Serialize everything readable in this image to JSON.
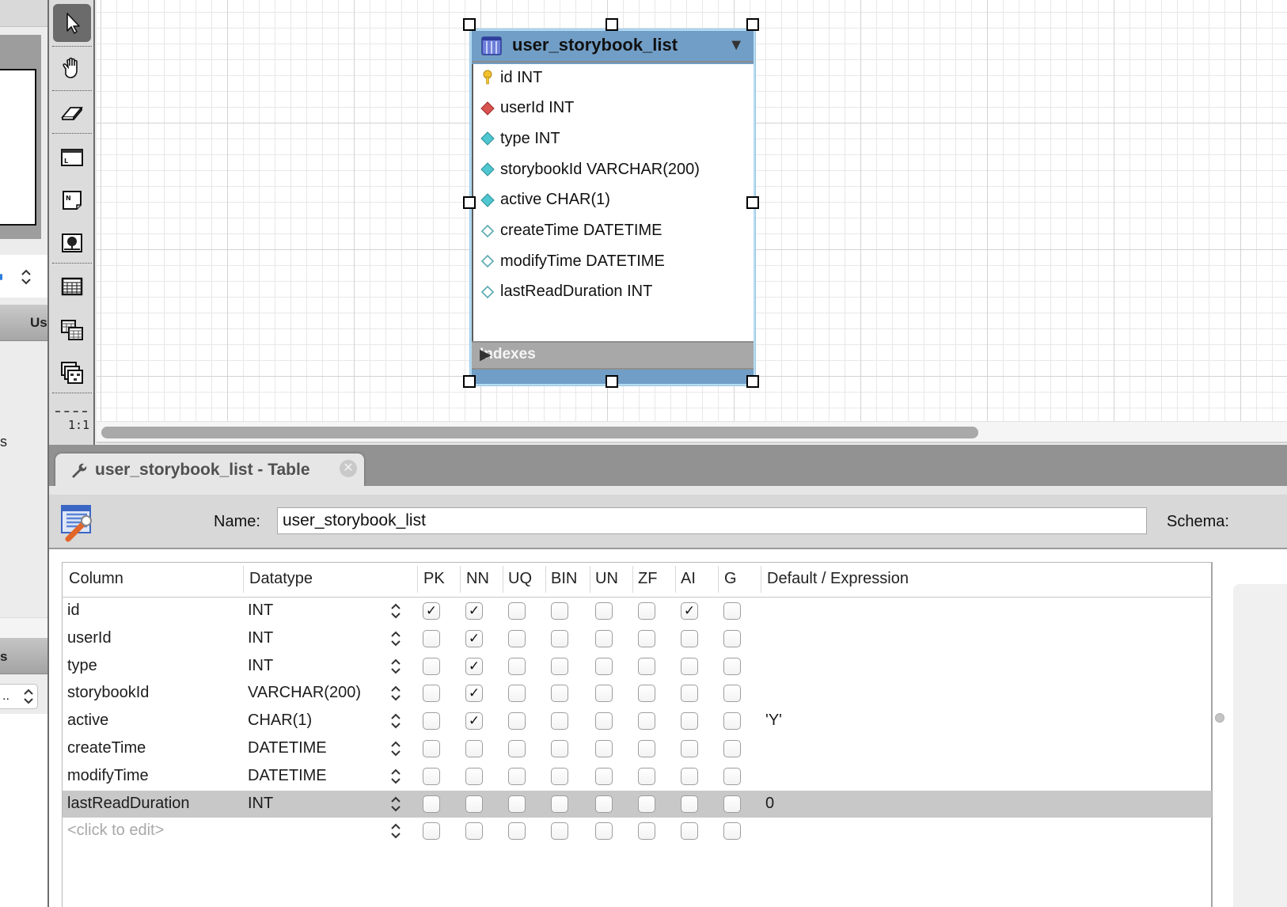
{
  "left_panel": {
    "header_fragment": "Us",
    "label_fragment": "s",
    "header2_fragment": "s",
    "select_fragment": "..",
    "stepper_glyph": "⌃⌄"
  },
  "toolbar": {
    "tools": [
      {
        "name": "pointer-tool",
        "icon": "pointer-icon",
        "active": true
      },
      {
        "name": "hand-tool",
        "icon": "hand-icon",
        "active": false
      },
      {
        "name": "eraser-tool",
        "icon": "eraser-icon",
        "active": false
      },
      {
        "name": "layer-tool",
        "icon": "layer-icon",
        "active": false
      },
      {
        "name": "note-tool",
        "icon": "note-icon",
        "active": false
      },
      {
        "name": "image-tool",
        "icon": "image-icon",
        "active": false
      },
      {
        "name": "new-table-tool",
        "icon": "table-icon",
        "active": false
      },
      {
        "name": "new-view-tool",
        "icon": "view-icon",
        "active": false
      },
      {
        "name": "new-routine-group-tool",
        "icon": "routine-group-icon",
        "active": false
      }
    ],
    "zoom_label": "1:1"
  },
  "diagram": {
    "table": {
      "title": "user_storybook_list",
      "columns": [
        {
          "text": "id INT",
          "key": "primary"
        },
        {
          "text": "userId INT",
          "key": "foreign"
        },
        {
          "text": "type INT",
          "key": "notnull"
        },
        {
          "text": "storybookId VARCHAR(200)",
          "key": "notnull"
        },
        {
          "text": "active CHAR(1)",
          "key": "notnull"
        },
        {
          "text": "createTime DATETIME",
          "key": "nullable"
        },
        {
          "text": "modifyTime DATETIME",
          "key": "nullable"
        },
        {
          "text": "lastReadDuration INT",
          "key": "nullable"
        }
      ],
      "indexes_label": "Indexes",
      "caret_down": "▼",
      "caret_right": "▶"
    },
    "colors": {
      "header": "#719ec6",
      "pk": "#f2c12e",
      "fk": "#d9534f",
      "nn": "#4fc6d0"
    }
  },
  "editor": {
    "tab_label": "user_storybook_list - Table",
    "tab_close": "✕",
    "name_label": "Name:",
    "name_value": "user_storybook_list",
    "schema_label": "Schema:",
    "grid": {
      "headers": [
        "Column",
        "Datatype",
        "PK",
        "NN",
        "UQ",
        "BIN",
        "UN",
        "ZF",
        "AI",
        "G",
        "Default / Expression"
      ],
      "rows": [
        {
          "column": "id",
          "datatype": "INT",
          "flags": [
            true,
            true,
            false,
            false,
            false,
            false,
            true,
            false
          ],
          "default": ""
        },
        {
          "column": "userId",
          "datatype": "INT",
          "flags": [
            false,
            true,
            false,
            false,
            false,
            false,
            false,
            false
          ],
          "default": ""
        },
        {
          "column": "type",
          "datatype": "INT",
          "flags": [
            false,
            true,
            false,
            false,
            false,
            false,
            false,
            false
          ],
          "default": ""
        },
        {
          "column": "storybookId",
          "datatype": "VARCHAR(200)",
          "flags": [
            false,
            true,
            false,
            false,
            false,
            false,
            false,
            false
          ],
          "default": ""
        },
        {
          "column": "active",
          "datatype": "CHAR(1)",
          "flags": [
            false,
            true,
            false,
            false,
            false,
            false,
            false,
            false
          ],
          "default": "'Y'"
        },
        {
          "column": "createTime",
          "datatype": "DATETIME",
          "flags": [
            false,
            false,
            false,
            false,
            false,
            false,
            false,
            false
          ],
          "default": ""
        },
        {
          "column": "modifyTime",
          "datatype": "DATETIME",
          "flags": [
            false,
            false,
            false,
            false,
            false,
            false,
            false,
            false
          ],
          "default": ""
        },
        {
          "column": "lastReadDuration",
          "datatype": "INT",
          "flags": [
            false,
            false,
            false,
            false,
            false,
            false,
            false,
            false
          ],
          "default": "0",
          "selected": true
        },
        {
          "column": "<click to edit>",
          "datatype": "",
          "flags": [
            false,
            false,
            false,
            false,
            false,
            false,
            false,
            false
          ],
          "default": "",
          "placeholder": true
        }
      ],
      "stepper_glyph": "⌃⌄",
      "check_glyph": "✓"
    }
  }
}
